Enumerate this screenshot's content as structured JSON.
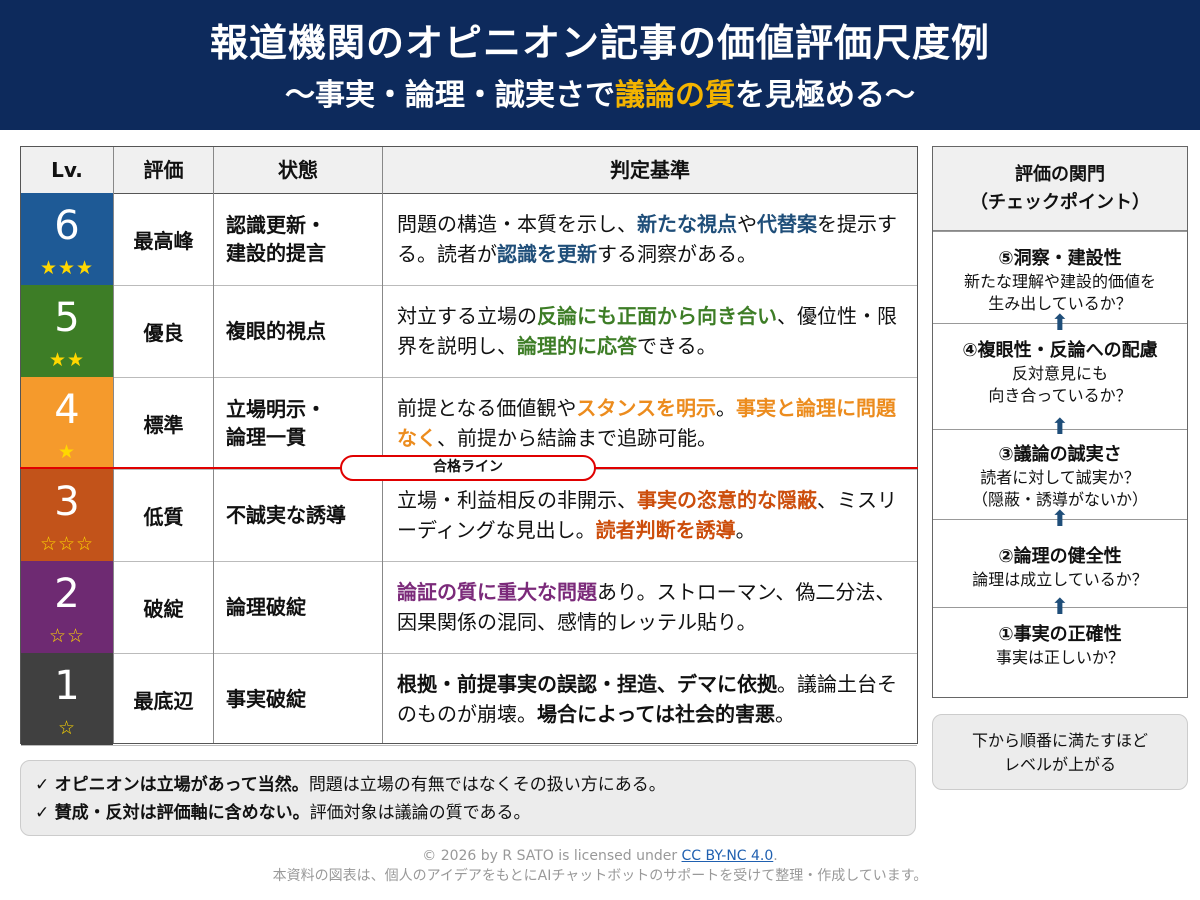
{
  "header": {
    "title": "報道機関のオピニオン記事の価値評価尺度例",
    "subtitle_pre": "〜事実・論理・誠実さで",
    "subtitle_highlight": "議論の質",
    "subtitle_post": "を見極める〜"
  },
  "table": {
    "headers": {
      "lv": "Lv.",
      "eval": "評価",
      "state": "状態",
      "criteria": "判定基準"
    },
    "rows": [
      {
        "level": "6",
        "stars": "★★★",
        "color": "#1e5a96",
        "eval": "最高峰",
        "state": "認識更新・建設的提言",
        "criteria": [
          {
            "t": "問題の構造・本質を示し、"
          },
          {
            "t": "新たな視点",
            "s": "c-blue"
          },
          {
            "t": "や"
          },
          {
            "t": "代替案",
            "s": "c-blue"
          },
          {
            "t": "を提示する。読者が"
          },
          {
            "t": "認識を更新",
            "s": "c-blue"
          },
          {
            "t": "する洞察がある。"
          }
        ]
      },
      {
        "level": "5",
        "stars": "★★",
        "color": "#3d7d26",
        "eval": "優良",
        "state": "複眼的視点",
        "criteria": [
          {
            "t": "対立する立場の"
          },
          {
            "t": "反論にも正面から向き合い",
            "s": "c-green"
          },
          {
            "t": "、優位性・限界を説明し、"
          },
          {
            "t": "論理的に応答",
            "s": "c-green"
          },
          {
            "t": "できる。"
          }
        ]
      },
      {
        "level": "4",
        "stars": "★",
        "color": "#f59a2c",
        "eval": "標準",
        "state": "立場明示・論理一貫",
        "criteria": [
          {
            "t": "前提となる価値観や"
          },
          {
            "t": "スタンスを明示",
            "s": "c-orange"
          },
          {
            "t": "。"
          },
          {
            "t": "事実と論理に問題なく",
            "s": "c-orange"
          },
          {
            "t": "、前提から結論まで追跡可能。"
          }
        ]
      },
      {
        "level": "3",
        "stars": "☆☆☆",
        "color": "#c2531a",
        "eval": "低質",
        "state": "不誠実な誘導",
        "criteria": [
          {
            "t": "立場・利益相反の非開示、"
          },
          {
            "t": "事実の恣意的な隠蔽",
            "s": "c-dorange"
          },
          {
            "t": "、ミスリーディングな見出し。"
          },
          {
            "t": "読者判断を誘導",
            "s": "c-dorange"
          },
          {
            "t": "。"
          }
        ]
      },
      {
        "level": "2",
        "stars": "☆☆",
        "color": "#6e2a72",
        "eval": "破綻",
        "state": "論理破綻",
        "criteria": [
          {
            "t": "論証の質に重大な問題",
            "s": "c-purple"
          },
          {
            "t": "あり。ストローマン、偽二分法、因果関係の混同、感情的レッテル貼り。"
          }
        ]
      },
      {
        "level": "1",
        "stars": "☆",
        "color": "#404040",
        "eval": "最底辺",
        "state": "事実破綻",
        "criteria": [
          {
            "t": "根拠・前提事実の誤認・捏造、デマに依拠",
            "s": "c-bold"
          },
          {
            "t": "。議論土台そのものが崩壊。"
          },
          {
            "t": "場合によっては社会的害悪",
            "s": "c-bold"
          },
          {
            "t": "。"
          }
        ]
      }
    ],
    "pass_line": "合格ライン"
  },
  "gate": {
    "title": "評価の関門\n（チェックポイント）",
    "steps": [
      {
        "title": "⑤洞察・建設性",
        "desc": "新たな理解や建設的価値を\n生み出しているか？"
      },
      {
        "title": "④複眼性・反論への配慮",
        "desc": "反対意見にも\n向き合っているか？"
      },
      {
        "title": "③議論の誠実さ",
        "desc": "読者に対して誠実か？\n（隠蔽・誘導がないか）"
      },
      {
        "title": "②論理の健全性",
        "desc": "論理は成立しているか？"
      },
      {
        "title": "①事実の正確性",
        "desc": "事実は正しいか？"
      }
    ],
    "arrow_icon": "up-arrow-icon"
  },
  "note": "下から順番に満たすほど\nレベルが上がる",
  "checks": [
    {
      "mark": "✓",
      "bold": "オピニオンは立場があって当然。",
      "text": "問題は立場の有無ではなくその扱い方にある。"
    },
    {
      "mark": "✓",
      "bold": "賛成・反対は評価軸に含めない。",
      "text": "評価対象は議論の質である。"
    }
  ],
  "footer": {
    "license_pre": "© 2026 by R SATO is licensed under ",
    "license_link": "CC BY-NC 4.0",
    "license_post": ".",
    "note": "本資料の図表は、個人のアイデアをもとにAIチャットボットのサポートを受けて整理・作成しています。"
  }
}
